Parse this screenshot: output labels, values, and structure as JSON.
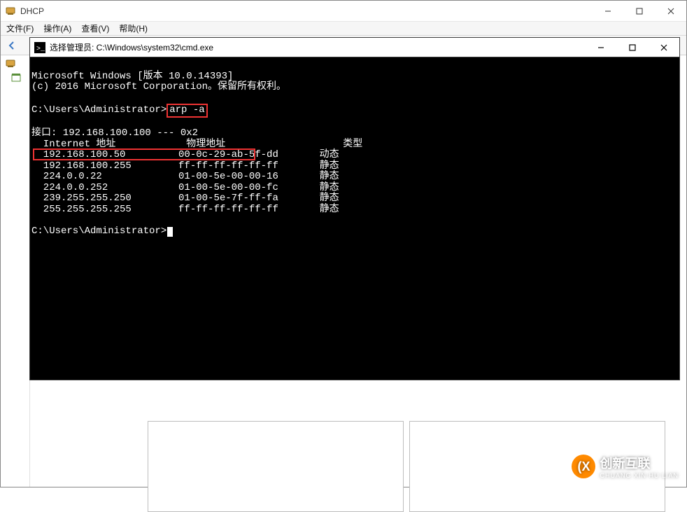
{
  "outer": {
    "title": "DHCP",
    "menu": {
      "file": "文件(F)",
      "action": "操作(A)",
      "view": "查看(V)",
      "help": "帮助(H)"
    },
    "toolbar": {
      "back": "back",
      "forward": "forward"
    }
  },
  "cmd": {
    "title": "选择管理员: C:\\Windows\\system32\\cmd.exe",
    "lines": {
      "banner1": "Microsoft Windows [版本 10.0.14393]",
      "banner2": "(c) 2016 Microsoft Corporation。保留所有权利。",
      "blank": "",
      "prompt1_prefix": "C:\\Users\\Administrator>",
      "prompt1_cmd": "arp -a",
      "iface": "接口: 192.168.100.100 --- 0x2",
      "hdr_ip": "  Internet 地址",
      "hdr_mac": "物理地址",
      "hdr_type": "类型",
      "r1_ip": "  192.168.100.50",
      "r1_mac": "00-0c-29-ab-5f-dd",
      "r1_type": "动态",
      "r2_ip": "  192.168.100.255",
      "r2_mac": "ff-ff-ff-ff-ff-ff",
      "r2_type": "静态",
      "r3_ip": "  224.0.0.22",
      "r3_mac": "01-00-5e-00-00-16",
      "r3_type": "静态",
      "r4_ip": "  224.0.0.252",
      "r4_mac": "01-00-5e-00-00-fc",
      "r4_type": "静态",
      "r5_ip": "  239.255.255.250",
      "r5_mac": "01-00-5e-7f-ff-fa",
      "r5_type": "静态",
      "r6_ip": "  255.255.255.255",
      "r6_mac": "ff-ff-ff-ff-ff-ff",
      "r6_type": "静态",
      "prompt2": "C:\\Users\\Administrator>"
    },
    "col_ip_width": 25,
    "col_mac_width": 24
  },
  "watermark": {
    "brand": "创新互联",
    "sub": "CHUANG XIN HU LIAN",
    "badge": "(X"
  }
}
